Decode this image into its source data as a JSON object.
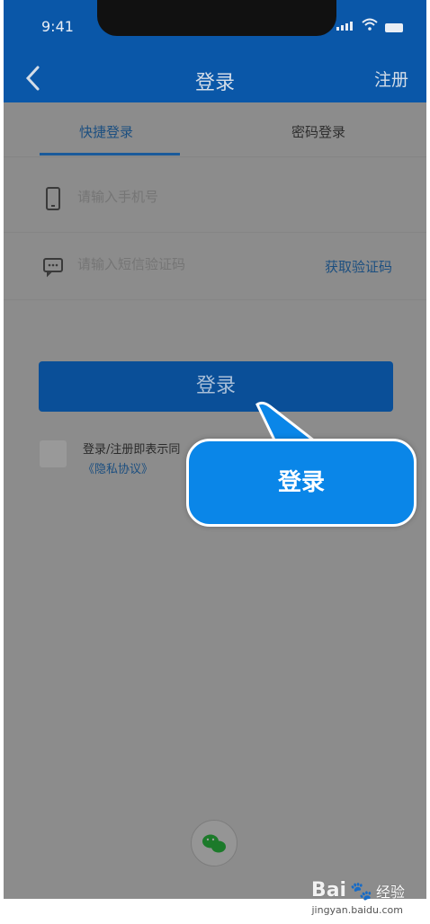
{
  "status_bar": {
    "time": "9:41"
  },
  "nav": {
    "title": "登录",
    "right_action": "注册"
  },
  "tabs": [
    {
      "label": "快捷登录",
      "active": true
    },
    {
      "label": "密码登录",
      "active": false
    }
  ],
  "form": {
    "phone_placeholder": "请输入手机号",
    "code_placeholder": "请输入短信验证码",
    "get_code_label": "获取验证码",
    "login_label": "登录"
  },
  "agreement": {
    "text": "登录/注册即表示同",
    "link": "《隐私协议》"
  },
  "callout": {
    "label": "登录"
  },
  "third_party": {
    "icon": "wechat-icon"
  },
  "watermark": {
    "logo": "Bai",
    "logo_suffix": "经验",
    "site": "jingyan.baidu.com"
  },
  "colors": {
    "header": "#0a57a8",
    "button": "#0a4f98",
    "callout": "#0a86e8",
    "overlay": "#8c8c8c"
  }
}
